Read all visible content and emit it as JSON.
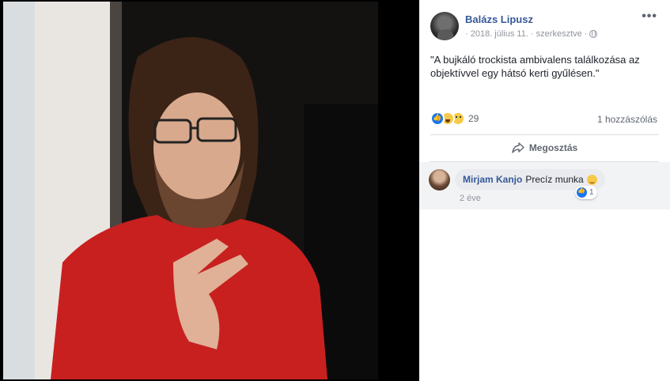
{
  "post": {
    "author": "Balázs Lipusz",
    "date": "· 2018. július 11. · szerkesztve ·",
    "privacy_icon": "globe-icon",
    "more_icon": "•••",
    "text": "\"A bujkáló trockista ambivalens találkozása az objektívvel egy hátsó kerti gyűlésen.\"",
    "reaction_icons": [
      "like-icon",
      "haha-icon",
      "sad-icon"
    ],
    "reaction_count": "29",
    "comment_count": "1 hozzászólás",
    "share_label": "Megosztás"
  },
  "comments": [
    {
      "author": "Mirjam Kanjo",
      "text": "Precíz munka",
      "emoji": "wink-emoji",
      "time": "2 éve",
      "reaction_count": "1"
    }
  ],
  "colors": {
    "link_blue": "#365899",
    "meta_gray": "#90949c",
    "like_blue": "#1877f2",
    "comment_bg": "#f2f3f5"
  }
}
